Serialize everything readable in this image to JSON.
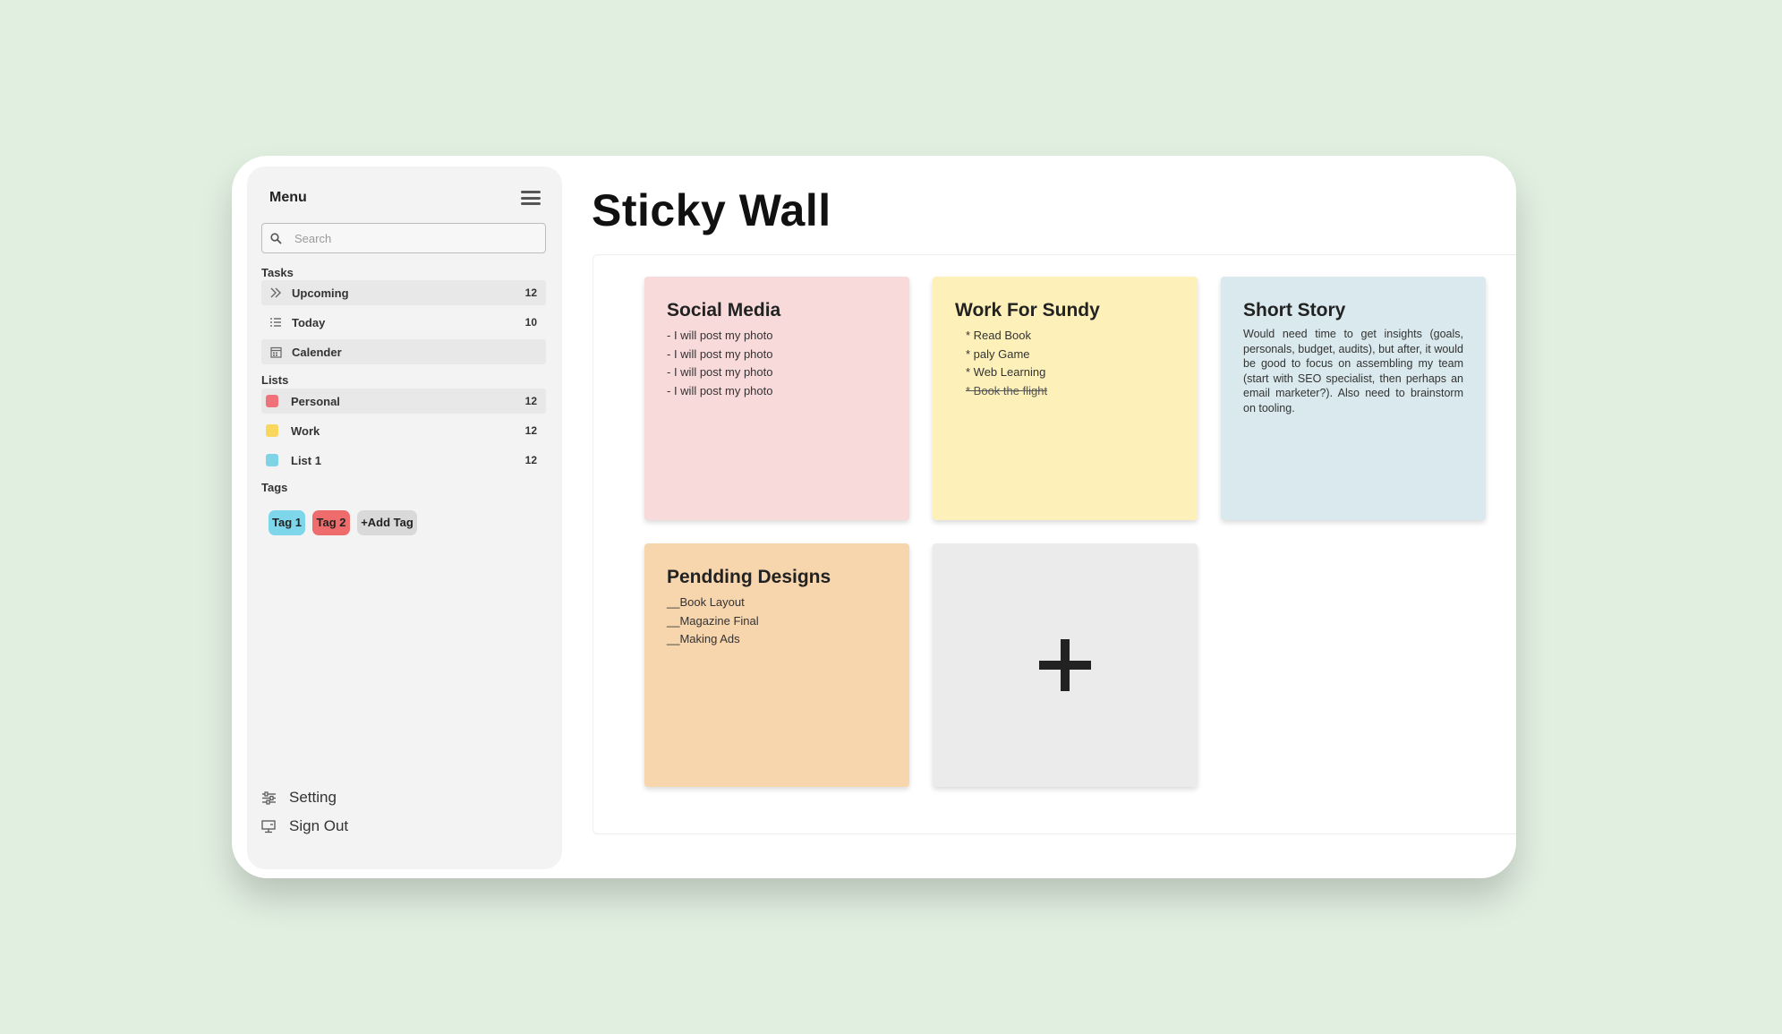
{
  "sidebar": {
    "title": "Menu",
    "search_placeholder": "Search",
    "tasks_title": "Tasks",
    "tasks": [
      {
        "label": "Upcoming",
        "count": "12",
        "icon": "double-chevron-right-icon"
      },
      {
        "label": "Today",
        "count": "10",
        "icon": "checklist-icon"
      },
      {
        "label": "Calender",
        "count": "",
        "icon": "calendar-icon"
      }
    ],
    "lists_title": "Lists",
    "lists": [
      {
        "label": "Personal",
        "count": "12",
        "color": "#f07178"
      },
      {
        "label": "Work",
        "count": "12",
        "color": "#f9d65c"
      },
      {
        "label": "List 1",
        "count": "12",
        "color": "#7ed3e6"
      }
    ],
    "tags_title": "Tags",
    "tags": [
      {
        "label": "Tag 1",
        "color": "#7ed6ea"
      },
      {
        "label": "Tag 2",
        "color": "#ee6c6c"
      },
      {
        "label": "+Add Tag",
        "color": "#d9d9d9"
      }
    ],
    "settings_label": "Setting",
    "signout_label": "Sign Out"
  },
  "main": {
    "title": "Sticky Wall",
    "notes": [
      {
        "title": "Social Media",
        "color": "#f8dada",
        "lines": [
          "- I will post my photo",
          "- I will post my photo",
          "- I will post my photo",
          "- I will post my photo"
        ]
      },
      {
        "title": "Work For Sundy",
        "color": "#fdf1b9",
        "lines": [
          "* Read Book",
          "* paly Game",
          "* Web Learning",
          "* Book the flight"
        ]
      },
      {
        "title": "Short Story",
        "color": "#d9e9ed",
        "body": "Would need time to get insights (goals, personals, budget, audits), but after, it would be good to focus on assembling my team (start with SEO specialist, then perhaps an email marketer?). Also need to brainstorm on tooling."
      },
      {
        "title": "Pendding Designs",
        "color": "#f7d5ad",
        "lines": [
          "__Book Layout",
          "__Magazine Final",
          "__Making Ads"
        ]
      }
    ],
    "add_icon": "plus-icon"
  }
}
